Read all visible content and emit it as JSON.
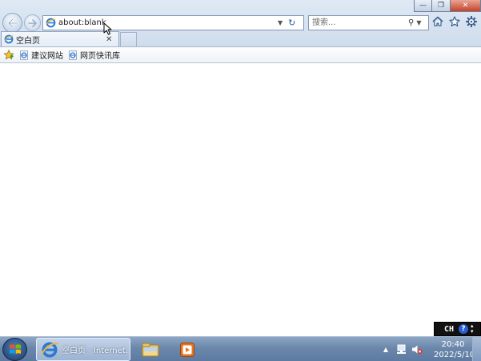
{
  "window_controls": {
    "minimize_symbol": "—",
    "maximize_symbol": "❐",
    "close_symbol": "✕"
  },
  "address_bar": {
    "value": "about:blank",
    "icon": "ie-page-icon",
    "dropdown_symbol": "▼",
    "refresh_symbol": "↻"
  },
  "search_bar": {
    "placeholder": "搜索...",
    "go_symbol": "⚲",
    "dropdown_symbol": "▼"
  },
  "command_icons": [
    "home-icon",
    "favorites-star-icon",
    "tools-gear-icon"
  ],
  "tab": {
    "title": "空白页",
    "close_symbol": "✕"
  },
  "favorites_bar": {
    "items": [
      {
        "label": "建议网站",
        "icon": "ie-page-icon"
      },
      {
        "label": "网页快讯库",
        "icon": "ie-page-icon"
      }
    ]
  },
  "ime": {
    "language": "CH",
    "help_symbol": "?"
  },
  "taskbar": {
    "ie_label": "空白页 - Internet...",
    "tray_arrow": "▲",
    "clock": {
      "time": "20:40",
      "date": "2022/5/10"
    }
  },
  "colors": {
    "chrome_blue": "#cfdcec",
    "taskbar_blue": "#6b87ab",
    "ie_blue": "#2b79d0",
    "close_red": "#c5432a"
  }
}
